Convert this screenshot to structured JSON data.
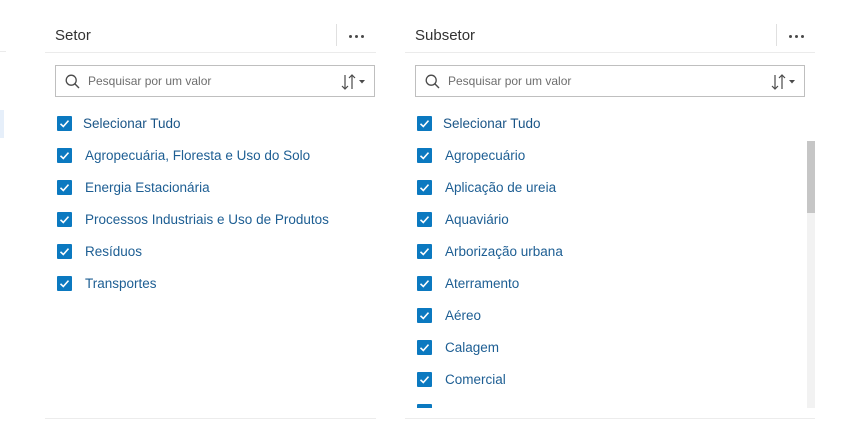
{
  "panels": {
    "left": {
      "title": "Setor",
      "search_placeholder": "Pesquisar por um valor",
      "select_all": "Selecionar Tudo",
      "items": [
        "Agropecuária, Floresta e Uso do Solo",
        "Energia Estacionária",
        "Processos Industriais e Uso de Produtos",
        "Resíduos",
        "Transportes"
      ]
    },
    "right": {
      "title": "Subsetor",
      "search_placeholder": "Pesquisar por um valor",
      "select_all": "Selecionar Tudo",
      "items": [
        "Agropecuário",
        "Aplicação de ureia",
        "Aquaviário",
        "Arborização urbana",
        "Aterramento",
        "Aéreo",
        "Calagem",
        "Comercial"
      ]
    }
  },
  "icons": {
    "more": "more-horizontal-icon",
    "search": "search-icon",
    "sort": "sort-icon",
    "checkbox": "checkbox-checked-icon"
  },
  "colors": {
    "accent": "#0b79c0",
    "label": "#1d5e93",
    "text": "#323232"
  }
}
